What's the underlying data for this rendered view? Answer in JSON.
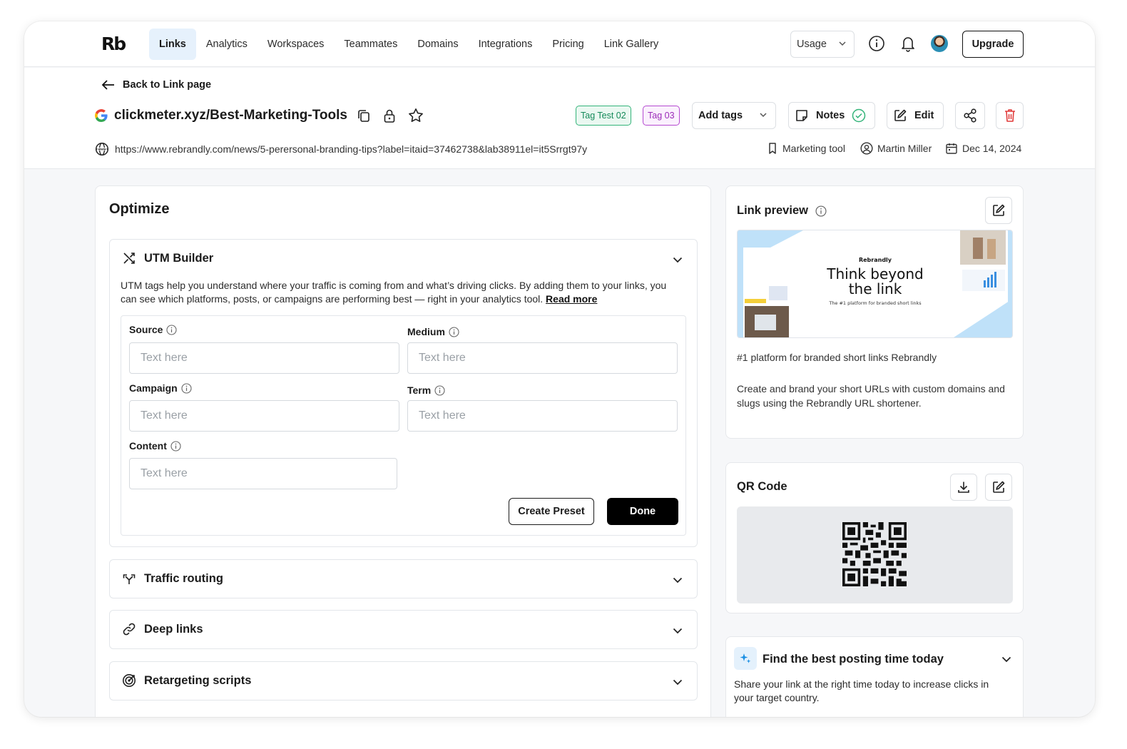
{
  "nav": {
    "logo": "Rb",
    "links": [
      "Links",
      "Analytics",
      "Workspaces",
      "Teammates",
      "Domains",
      "Integrations",
      "Pricing",
      "Link Gallery"
    ],
    "usage_label": "Usage",
    "upgrade_label": "Upgrade"
  },
  "header": {
    "back_label": "Back to Link page",
    "short_link": "clickmeter.xyz/Best-Marketing-Tools",
    "tags": [
      "Tag Test 02",
      "Tag  03"
    ],
    "add_tags_label": "Add tags",
    "notes_label": "Notes",
    "edit_label": "Edit",
    "long_url": "https://www.rebrandly.com/news/5-perersonal-branding-tips?label=itaid=37462738&lab38911el=it5Srrgt97y",
    "category": "Marketing tool",
    "owner": "Martin Miller",
    "date": "Dec 14, 2024"
  },
  "optimize": {
    "title": "Optimize",
    "utm": {
      "title": "UTM Builder",
      "description": "UTM tags help you understand where your traffic is coming from and what’s driving clicks. By adding them to your links, you can see which platforms, posts, or campaigns are performing best — right in your analytics tool.",
      "read_more": "Read more",
      "fields": {
        "source": {
          "label": "Source",
          "placeholder": "Text here"
        },
        "medium": {
          "label": "Medium",
          "placeholder": "Text here"
        },
        "campaign": {
          "label": "Campaign",
          "placeholder": "Text here"
        },
        "term": {
          "label": "Term",
          "placeholder": "Text here"
        },
        "content": {
          "label": "Content",
          "placeholder": "Text here"
        }
      },
      "create_preset_label": "Create Preset",
      "done_label": "Done"
    },
    "sections": [
      "Traffic routing",
      "Deep links",
      "Retargeting scripts"
    ]
  },
  "preview": {
    "title": "Link preview",
    "image_brand": "Rebrandly",
    "image_headline_1": "Think beyond",
    "image_headline_2": "the link",
    "image_tagline": "The #1 platform for branded short links",
    "meta_title": "#1 platform for branded short links Rebrandly",
    "meta_description": "Create and brand your short URLs with custom domains and slugs using the Rebrandly URL shortener."
  },
  "qr": {
    "title": "QR Code"
  },
  "best_time": {
    "title": "Find the best posting time today",
    "text": "Share your link at the right time today to increase clicks in your target country."
  },
  "colors": {
    "nav_active_bg": "#e6f1fc",
    "tag1": "#158a5a",
    "tag2": "#9b2bb8",
    "notes_check": "#34b47a",
    "delete": "#e03a3a",
    "accent_blue": "#1a8fe3"
  }
}
